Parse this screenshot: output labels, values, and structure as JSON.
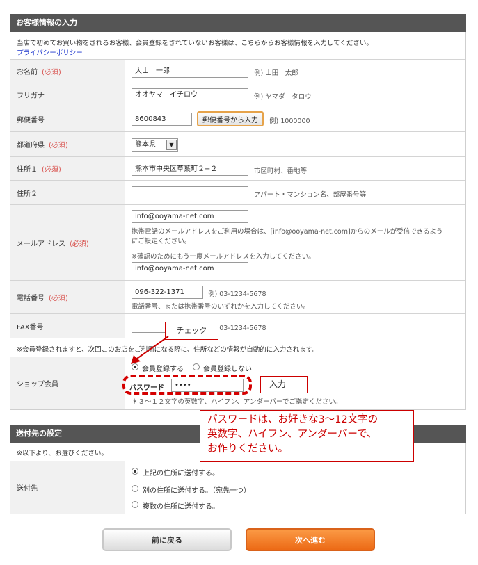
{
  "customer": {
    "heading": "お客様情報の入力",
    "intro": "当店で初めてお買い物をされるお客様、会員登録をされていないお客様は、こちらからお客様情報を入力してください。",
    "privacy_link": "プライバシーポリシー",
    "required_mark": "(必須)",
    "name": {
      "label": "お名前",
      "value": "大山　一郎",
      "hint": "例) 山田　太郎"
    },
    "kana": {
      "label": "フリガナ",
      "value": "オオヤマ　イチロウ",
      "hint": "例) ヤマダ　タロウ"
    },
    "zip": {
      "label": "郵便番号",
      "value": "8600843",
      "button": "郵便番号から入力",
      "hint": "例) 1000000"
    },
    "pref": {
      "label": "都道府県",
      "value": "熊本県"
    },
    "addr1": {
      "label": "住所１",
      "value": "熊本市中央区草葉町２−２",
      "hint": "市区町村、番地等"
    },
    "addr2": {
      "label": "住所２",
      "value": "",
      "hint": "アパート・マンション名、部屋番号等"
    },
    "email": {
      "label": "メールアドレス",
      "value": "info@ooyama-net.com",
      "note1": "携帯電話のメールアドレスをご利用の場合は、[info@ooyama-net.com]からのメールが受信できるよう",
      "note2": "にご設定ください。",
      "confirm_note": "※確認のためにもう一度メールアドレスを入力してください。",
      "confirm_value": "info@ooyama-net.com"
    },
    "tel": {
      "label": "電話番号",
      "value": "096-322-1371",
      "hint": "例) 03-1234-5678",
      "note": "電話番号、または携帯番号のいずれかを入力してください。"
    },
    "fax": {
      "label": "FAX番号",
      "value": "",
      "hint": "例) 03-1234-5678"
    },
    "member_notice": "※会員登録されますと、次回このお店をご利用になる際に、住所などの情報が自動的に入力されます。",
    "shop_member": {
      "label": "ショップ会員",
      "option_register": "会員登録する",
      "option_no_register": "会員登録しない",
      "password_label": "パスワード",
      "password_value": "••••",
      "password_note": "＊３〜１２文字の英数字、ハイフン、アンダーバーでご指定ください。"
    }
  },
  "delivery": {
    "heading": "送付先の設定",
    "note": "※以下より、お選びください。",
    "label": "送付先",
    "options": [
      "上記の住所に送付する。",
      "別の住所に送付する。（宛先一つ）",
      "複数の住所に送付する。"
    ]
  },
  "annotations": {
    "check": "チェック",
    "input": "入力",
    "password_info_1": "パスワードは、お好きな3〜12文字の",
    "password_info_2": "英数字、ハイフン、アンダーバーで、",
    "password_info_3": "お作りください。"
  },
  "buttons": {
    "back": "前に戻る",
    "next": "次へ進む"
  },
  "colors": {
    "header": "#555555",
    "required": "#d9534f",
    "accent": "#f07a1e",
    "annotation": "#cc0000",
    "link": "#1a33cc"
  }
}
